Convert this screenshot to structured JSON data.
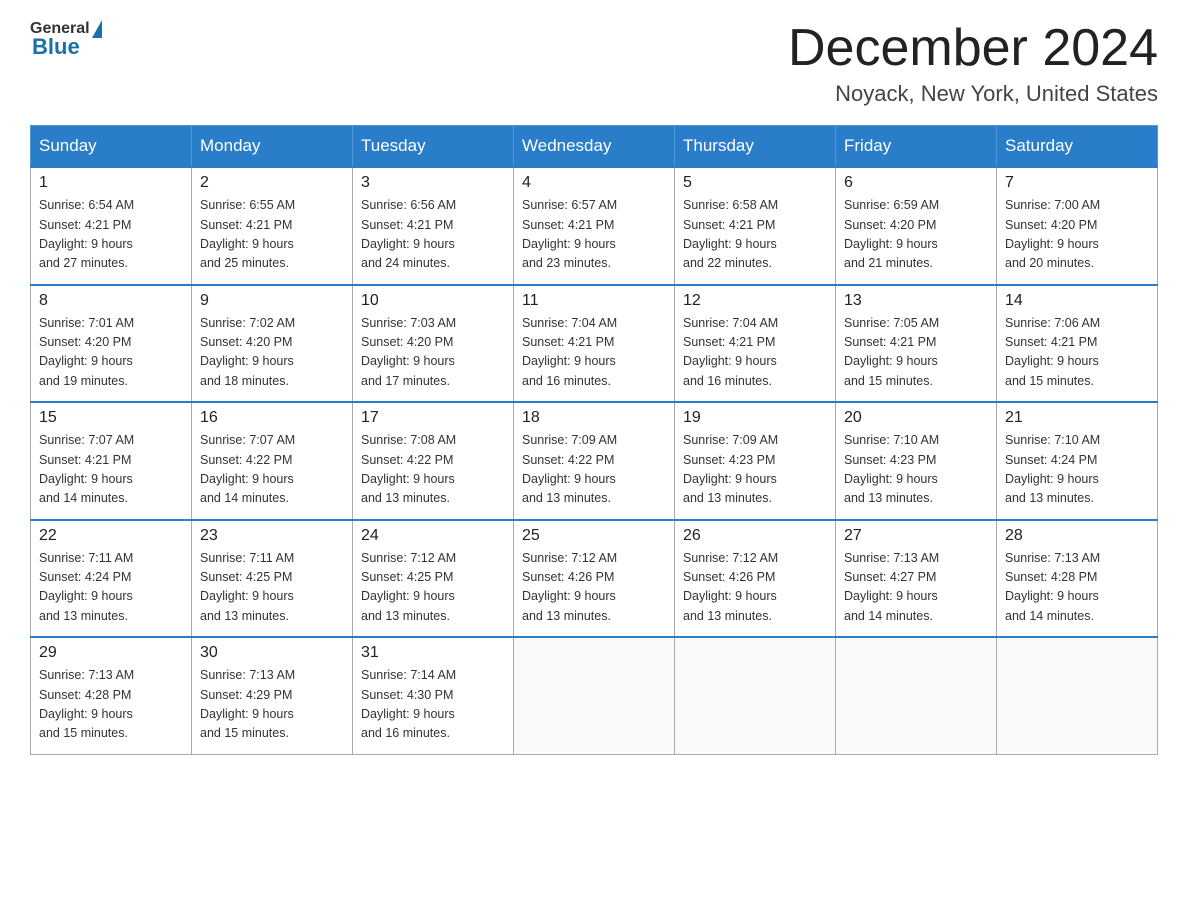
{
  "header": {
    "logo_general": "General",
    "logo_blue": "Blue",
    "month_title": "December 2024",
    "location": "Noyack, New York, United States"
  },
  "days_of_week": [
    "Sunday",
    "Monday",
    "Tuesday",
    "Wednesday",
    "Thursday",
    "Friday",
    "Saturday"
  ],
  "weeks": [
    [
      {
        "day": "1",
        "sunrise": "6:54 AM",
        "sunset": "4:21 PM",
        "daylight": "9 hours and 27 minutes."
      },
      {
        "day": "2",
        "sunrise": "6:55 AM",
        "sunset": "4:21 PM",
        "daylight": "9 hours and 25 minutes."
      },
      {
        "day": "3",
        "sunrise": "6:56 AM",
        "sunset": "4:21 PM",
        "daylight": "9 hours and 24 minutes."
      },
      {
        "day": "4",
        "sunrise": "6:57 AM",
        "sunset": "4:21 PM",
        "daylight": "9 hours and 23 minutes."
      },
      {
        "day": "5",
        "sunrise": "6:58 AM",
        "sunset": "4:21 PM",
        "daylight": "9 hours and 22 minutes."
      },
      {
        "day": "6",
        "sunrise": "6:59 AM",
        "sunset": "4:20 PM",
        "daylight": "9 hours and 21 minutes."
      },
      {
        "day": "7",
        "sunrise": "7:00 AM",
        "sunset": "4:20 PM",
        "daylight": "9 hours and 20 minutes."
      }
    ],
    [
      {
        "day": "8",
        "sunrise": "7:01 AM",
        "sunset": "4:20 PM",
        "daylight": "9 hours and 19 minutes."
      },
      {
        "day": "9",
        "sunrise": "7:02 AM",
        "sunset": "4:20 PM",
        "daylight": "9 hours and 18 minutes."
      },
      {
        "day": "10",
        "sunrise": "7:03 AM",
        "sunset": "4:20 PM",
        "daylight": "9 hours and 17 minutes."
      },
      {
        "day": "11",
        "sunrise": "7:04 AM",
        "sunset": "4:21 PM",
        "daylight": "9 hours and 16 minutes."
      },
      {
        "day": "12",
        "sunrise": "7:04 AM",
        "sunset": "4:21 PM",
        "daylight": "9 hours and 16 minutes."
      },
      {
        "day": "13",
        "sunrise": "7:05 AM",
        "sunset": "4:21 PM",
        "daylight": "9 hours and 15 minutes."
      },
      {
        "day": "14",
        "sunrise": "7:06 AM",
        "sunset": "4:21 PM",
        "daylight": "9 hours and 15 minutes."
      }
    ],
    [
      {
        "day": "15",
        "sunrise": "7:07 AM",
        "sunset": "4:21 PM",
        "daylight": "9 hours and 14 minutes."
      },
      {
        "day": "16",
        "sunrise": "7:07 AM",
        "sunset": "4:22 PM",
        "daylight": "9 hours and 14 minutes."
      },
      {
        "day": "17",
        "sunrise": "7:08 AM",
        "sunset": "4:22 PM",
        "daylight": "9 hours and 13 minutes."
      },
      {
        "day": "18",
        "sunrise": "7:09 AM",
        "sunset": "4:22 PM",
        "daylight": "9 hours and 13 minutes."
      },
      {
        "day": "19",
        "sunrise": "7:09 AM",
        "sunset": "4:23 PM",
        "daylight": "9 hours and 13 minutes."
      },
      {
        "day": "20",
        "sunrise": "7:10 AM",
        "sunset": "4:23 PM",
        "daylight": "9 hours and 13 minutes."
      },
      {
        "day": "21",
        "sunrise": "7:10 AM",
        "sunset": "4:24 PM",
        "daylight": "9 hours and 13 minutes."
      }
    ],
    [
      {
        "day": "22",
        "sunrise": "7:11 AM",
        "sunset": "4:24 PM",
        "daylight": "9 hours and 13 minutes."
      },
      {
        "day": "23",
        "sunrise": "7:11 AM",
        "sunset": "4:25 PM",
        "daylight": "9 hours and 13 minutes."
      },
      {
        "day": "24",
        "sunrise": "7:12 AM",
        "sunset": "4:25 PM",
        "daylight": "9 hours and 13 minutes."
      },
      {
        "day": "25",
        "sunrise": "7:12 AM",
        "sunset": "4:26 PM",
        "daylight": "9 hours and 13 minutes."
      },
      {
        "day": "26",
        "sunrise": "7:12 AM",
        "sunset": "4:26 PM",
        "daylight": "9 hours and 13 minutes."
      },
      {
        "day": "27",
        "sunrise": "7:13 AM",
        "sunset": "4:27 PM",
        "daylight": "9 hours and 14 minutes."
      },
      {
        "day": "28",
        "sunrise": "7:13 AM",
        "sunset": "4:28 PM",
        "daylight": "9 hours and 14 minutes."
      }
    ],
    [
      {
        "day": "29",
        "sunrise": "7:13 AM",
        "sunset": "4:28 PM",
        "daylight": "9 hours and 15 minutes."
      },
      {
        "day": "30",
        "sunrise": "7:13 AM",
        "sunset": "4:29 PM",
        "daylight": "9 hours and 15 minutes."
      },
      {
        "day": "31",
        "sunrise": "7:14 AM",
        "sunset": "4:30 PM",
        "daylight": "9 hours and 16 minutes."
      },
      null,
      null,
      null,
      null
    ]
  ],
  "labels": {
    "sunrise": "Sunrise:",
    "sunset": "Sunset:",
    "daylight": "Daylight:"
  }
}
